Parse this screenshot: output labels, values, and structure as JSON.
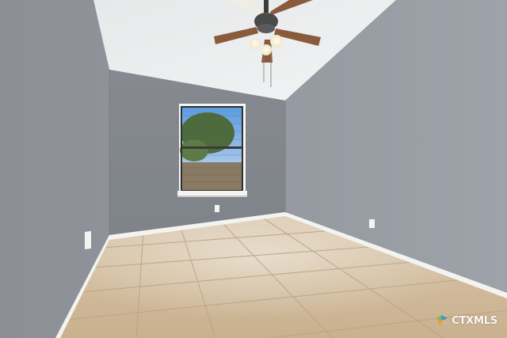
{
  "watermark": {
    "text": "CTXMLS",
    "logo_icon": "ctxmls-logo-icon",
    "colors": {
      "green": "#6cc04a",
      "blue": "#2f8fd8",
      "orange": "#f39a2b"
    }
  },
  "palette": {
    "wall": "#8d9197",
    "ceiling": "#eceeef",
    "floor_tile": "#d3bfa3",
    "baseboard": "#f3f3f1",
    "fan_blade": "#8a5a3c"
  }
}
